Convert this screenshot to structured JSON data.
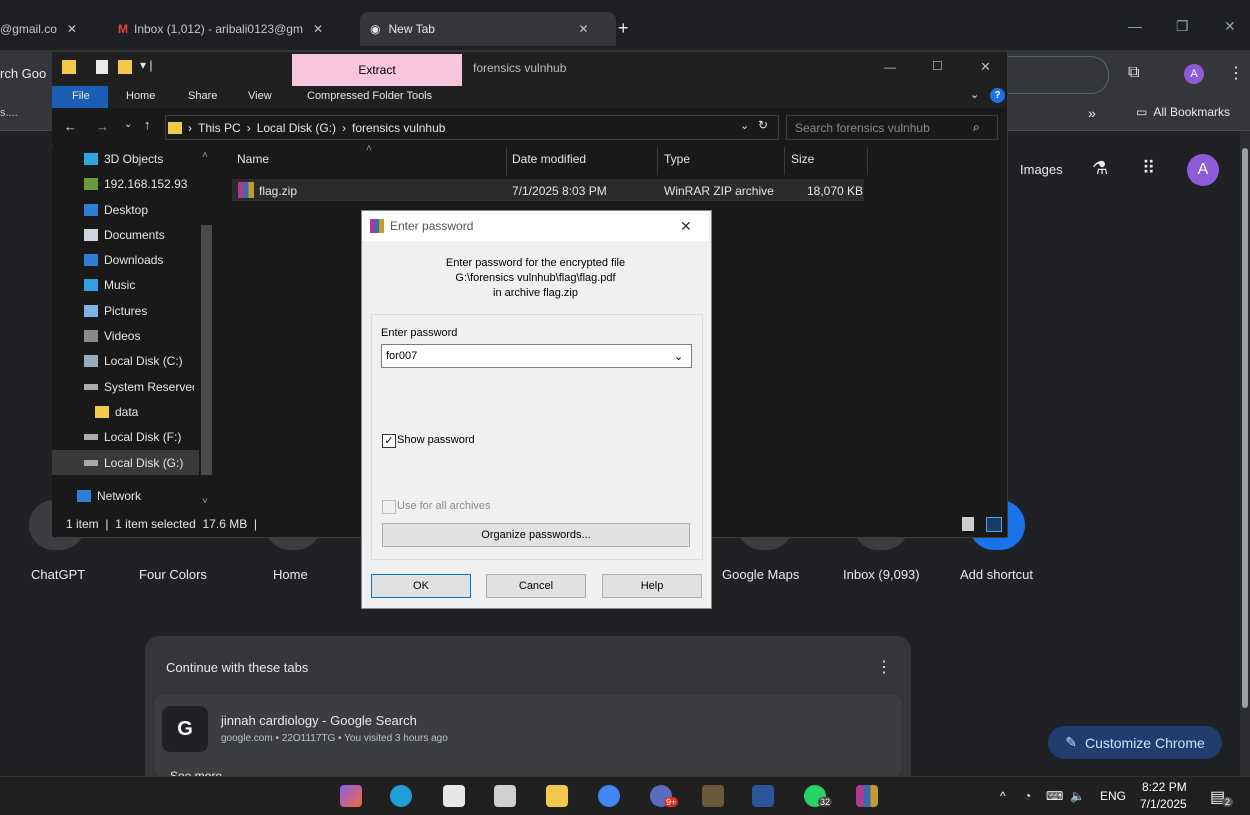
{
  "chrome": {
    "tabs": [
      {
        "label": "@gmail.co"
      },
      {
        "label": "Inbox (1,012) - aribali0123@gm"
      },
      {
        "label": "New Tab"
      }
    ],
    "new_tab_symbol": "+",
    "omnibox_fragment": "rch Goo",
    "bookmarks_fragment": "s....",
    "bookmarks_more": "»",
    "all_bookmarks": "All Bookmarks",
    "profile_initial": "A",
    "images_link": "Images",
    "shortcuts": [
      "ChatGPT",
      "Four Colors",
      "Home",
      "Google Maps",
      "Inbox (9,093)",
      "Add shortcut"
    ],
    "continue_title": "Continue with these tabs",
    "continue_item_title": "jinnah cardiology - Google Search",
    "continue_item_sub": "google.com • 22O1117TG • You visited 3 hours ago",
    "see_more_fragment": "See more",
    "customize_label": "Customize Chrome"
  },
  "explorer": {
    "title_tab": "Extract",
    "title_name": "forensics vulnhub",
    "ribbon": [
      "File",
      "Home",
      "Share",
      "View",
      "Compressed Folder Tools"
    ],
    "breadcrumb": [
      "This PC",
      "Local Disk (G:)",
      "forensics vulnhub"
    ],
    "search_placeholder": "Search forensics vulnhub",
    "nav_items": [
      "3D Objects",
      "192.168.152.93",
      "Desktop",
      "Documents",
      "Downloads",
      "Music",
      "Pictures",
      "Videos",
      "Local Disk (C:)",
      "System Reservec",
      "data",
      "Local Disk (F:)",
      "Local Disk (G:)",
      "Network"
    ],
    "columns": [
      "Name",
      "Date modified",
      "Type",
      "Size"
    ],
    "file": {
      "name": "flag.zip",
      "date": "7/1/2025 8:03 PM",
      "type": "WinRAR ZIP archive",
      "size": "18,070 KB"
    },
    "status": "1 item  |  1 item selected  17.6 MB  |"
  },
  "dialog": {
    "title": "Enter password",
    "line1": "Enter password for the encrypted file",
    "line2": "G:\\forensics vulnhub\\flag\\flag.pdf",
    "line3": "in archive flag.zip",
    "field_label": "Enter password",
    "password_value": "for007",
    "show_password": "Show password",
    "use_all": "Use for all archives",
    "organize": "Organize passwords...",
    "ok": "OK",
    "cancel": "Cancel",
    "help": "Help"
  },
  "taskbar": {
    "time": "8:22 PM",
    "date": "7/1/2025",
    "lang": "ENG",
    "whatsapp_badge": "32",
    "notif_badge": "2",
    "chrome_badge": "9+"
  },
  "colors": {
    "accent": "#1a73e8",
    "pink_tab": "#f9c5dc",
    "folder": "#f2c94c"
  }
}
